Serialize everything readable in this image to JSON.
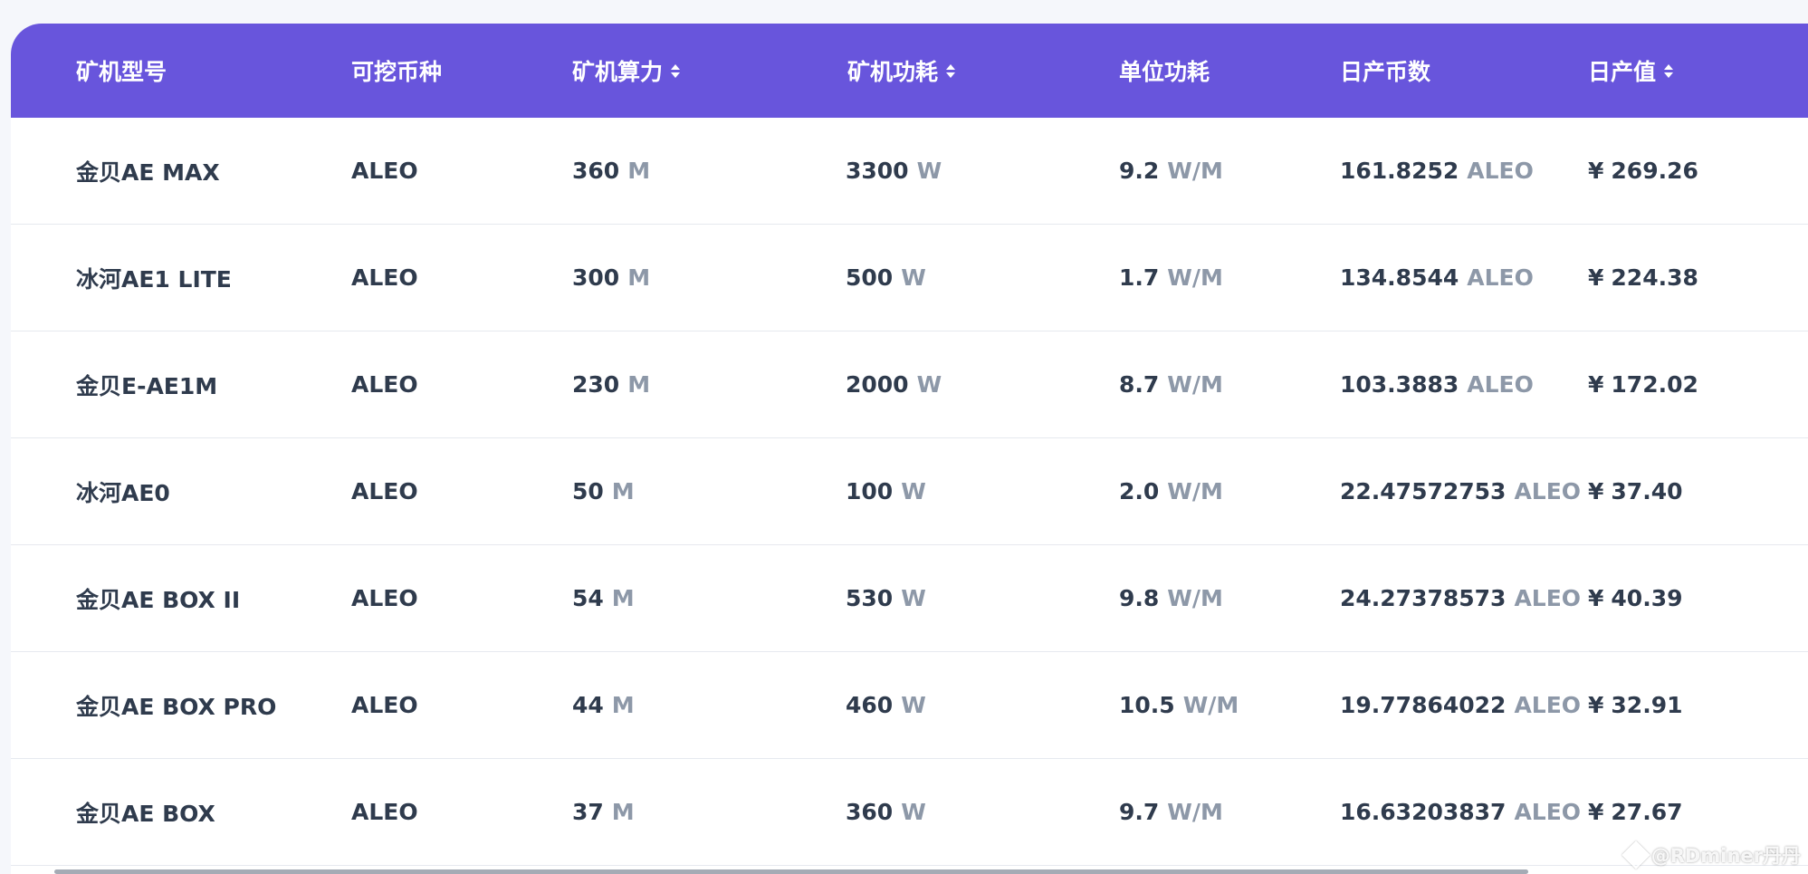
{
  "table": {
    "columns": [
      {
        "label": "矿机型号",
        "sortable": false
      },
      {
        "label": "可挖币种",
        "sortable": false
      },
      {
        "label": "矿机算力",
        "sortable": true
      },
      {
        "label": "矿机功耗",
        "sortable": true
      },
      {
        "label": "单位功耗",
        "sortable": false
      },
      {
        "label": "日产币数",
        "sortable": false
      },
      {
        "label": "日产值",
        "sortable": true
      }
    ],
    "rows": [
      {
        "model": "金贝AE MAX",
        "coin": "ALEO",
        "hashrate": "360",
        "hashrate_unit": "M",
        "power": "3300",
        "power_unit": "W",
        "efficiency": "9.2",
        "efficiency_unit": "W/M",
        "daily_coins": "161.8252",
        "daily_coins_unit": "ALEO",
        "currency": "¥",
        "daily_value": "269.26"
      },
      {
        "model": "冰河AE1 LITE",
        "coin": "ALEO",
        "hashrate": "300",
        "hashrate_unit": "M",
        "power": "500",
        "power_unit": "W",
        "efficiency": "1.7",
        "efficiency_unit": "W/M",
        "daily_coins": "134.8544",
        "daily_coins_unit": "ALEO",
        "currency": "¥",
        "daily_value": "224.38"
      },
      {
        "model": "金贝E-AE1M",
        "coin": "ALEO",
        "hashrate": "230",
        "hashrate_unit": "M",
        "power": "2000",
        "power_unit": "W",
        "efficiency": "8.7",
        "efficiency_unit": "W/M",
        "daily_coins": "103.3883",
        "daily_coins_unit": "ALEO",
        "currency": "¥",
        "daily_value": "172.02"
      },
      {
        "model": "冰河AE0",
        "coin": "ALEO",
        "hashrate": "50",
        "hashrate_unit": "M",
        "power": "100",
        "power_unit": "W",
        "efficiency": "2.0",
        "efficiency_unit": "W/M",
        "daily_coins": "22.47572753",
        "daily_coins_unit": "ALEO",
        "currency": "¥",
        "daily_value": "37.40"
      },
      {
        "model": "金贝AE BOX II",
        "coin": "ALEO",
        "hashrate": "54",
        "hashrate_unit": "M",
        "power": "530",
        "power_unit": "W",
        "efficiency": "9.8",
        "efficiency_unit": "W/M",
        "daily_coins": "24.27378573",
        "daily_coins_unit": "ALEO",
        "currency": "¥",
        "daily_value": "40.39"
      },
      {
        "model": "金贝AE BOX PRO",
        "coin": "ALEO",
        "hashrate": "44",
        "hashrate_unit": "M",
        "power": "460",
        "power_unit": "W",
        "efficiency": "10.5",
        "efficiency_unit": "W/M",
        "daily_coins": "19.77864022",
        "daily_coins_unit": "ALEO",
        "currency": "¥",
        "daily_value": "32.91"
      },
      {
        "model": "金贝AE BOX",
        "coin": "ALEO",
        "hashrate": "37",
        "hashrate_unit": "M",
        "power": "360",
        "power_unit": "W",
        "efficiency": "9.7",
        "efficiency_unit": "W/M",
        "daily_coins": "16.63203837",
        "daily_coins_unit": "ALEO",
        "currency": "¥",
        "daily_value": "27.67"
      }
    ]
  },
  "watermark": {
    "text": "@RDminer丹丹"
  },
  "colors": {
    "header_bg": "#6855dc",
    "text": "#2f3b4d",
    "unit_text": "#8d98a8",
    "row_border": "#e6e9ef"
  },
  "icons": {
    "sort": "sort-arrows-icon",
    "watermark": "diamond-logo-icon"
  }
}
